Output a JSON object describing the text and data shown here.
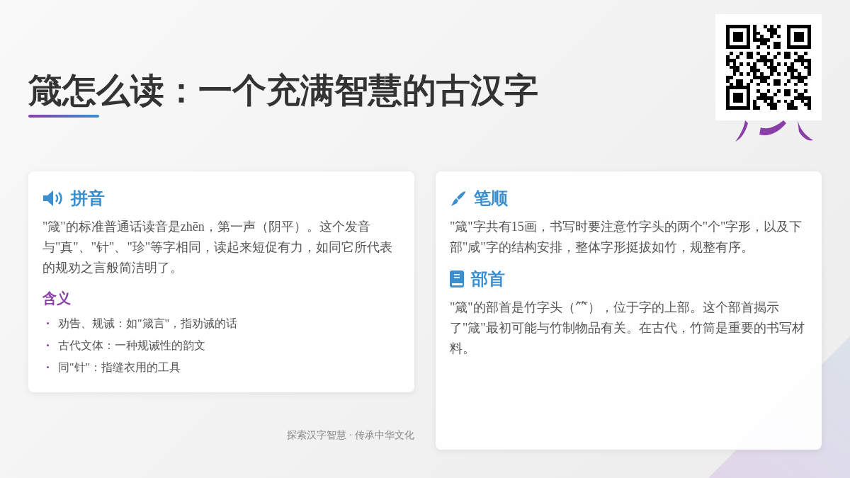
{
  "title": "箴怎么读：一个充满智慧的古汉字",
  "left_card": {
    "kind": "speaker",
    "heading": "拼音",
    "paragraph": "\"箴\"的标准普通话读音是zhēn，第一声（阴平）。这个发音与\"真\"、\"针\"、\"珍\"等字相同，读起来短促有力，如同它所代表的规劝之言般简洁明了。",
    "subheading": "含义",
    "meanings": [
      "劝告、规诫：如\"箴言\"，指劝诫的话",
      "古代文体：一种规诫性的韵文",
      "同\"针\"：指缝衣用的工具"
    ]
  },
  "right_card": {
    "sections": [
      {
        "kind": "brush",
        "heading": "笔顺",
        "paragraph": "\"箴\"字共有15画，书写时要注意竹字头的两个\"个\"字形，以及下部\"咸\"字的结构安排，整体字形挺拔如竹，规整有序。"
      },
      {
        "kind": "book",
        "heading": "部首",
        "paragraph": "\"箴\"的部首是竹字头（⺮），位于字的上部。这个部首揭示了\"箴\"最初可能与竹制物品有关。在古代，竹筒是重要的书写材料。"
      }
    ]
  },
  "footer": "探索汉字智慧 · 传承中华文化"
}
